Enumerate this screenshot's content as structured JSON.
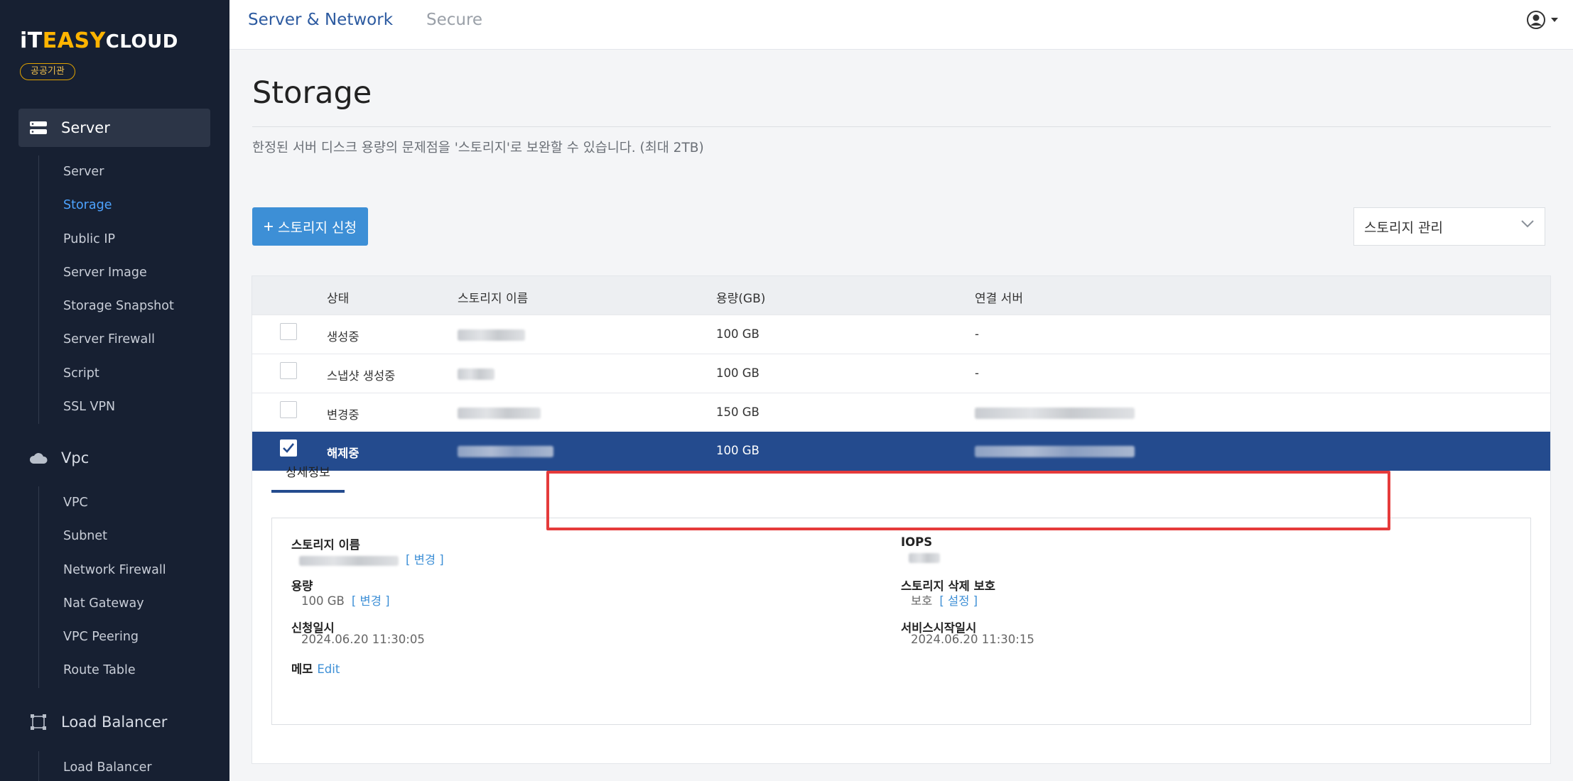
{
  "brand": {
    "logo_part1": "iT",
    "logo_part2": "EASY",
    "logo_part3": "CLOUD",
    "org_badge": "공공기관"
  },
  "sidebar": {
    "server_group": "Server",
    "server_items": [
      "Server",
      "Storage",
      "Public IP",
      "Server Image",
      "Storage Snapshot",
      "Server Firewall",
      "Script",
      "SSL VPN"
    ],
    "vpc_group": "Vpc",
    "vpc_items": [
      "VPC",
      "Subnet",
      "Network Firewall",
      "Nat Gateway",
      "VPC Peering",
      "Route Table"
    ],
    "lb_group": "Load Balancer",
    "lb_items": [
      "Load Balancer"
    ]
  },
  "topbar": {
    "tab_server_network": "Server & Network",
    "tab_secure": "Secure"
  },
  "page": {
    "title": "Storage",
    "description": "한정된 서버 디스크 용량의 문제점을 '스토리지'로 보완할 수 있습니다. (최대 2TB)",
    "request_button": "스토리지 신청",
    "manage_select": "스토리지 관리"
  },
  "table": {
    "columns": [
      "상태",
      "스토리지 이름",
      "용량(GB)",
      "연결 서버"
    ],
    "rows": [
      {
        "status": "생성중",
        "capacity": "100 GB",
        "server": "-",
        "checked": false
      },
      {
        "status": "스냅샷 생성중",
        "capacity": "100 GB",
        "server": "-",
        "checked": false
      },
      {
        "status": "변경중",
        "capacity": "150 GB",
        "server": "",
        "checked": false
      },
      {
        "status": "해제중",
        "capacity": "100 GB",
        "server": "",
        "checked": true
      }
    ]
  },
  "detail": {
    "tab": "상세정보",
    "storage_name_label": "스토리지 이름",
    "change_link": "[ 변경 ]",
    "capacity_label": "용량",
    "capacity_value": "100 GB",
    "requested_label": "신청일시",
    "requested_value": "2024.06.20 11:30:05",
    "memo_label": "메모",
    "memo_edit": "Edit",
    "iops_label": "IOPS",
    "delete_protect_label": "스토리지 삭제 보호",
    "delete_protect_value": "보호",
    "settings_link": "[ 설정 ]",
    "service_start_label": "서비스시작일시",
    "service_start_value": "2024.06.20 11:30:15"
  },
  "colors": {
    "sidebar_bg": "#172032",
    "accent_blue": "#3d8fd6",
    "selected_row": "#244b8e",
    "highlight": "#e53b3b"
  }
}
